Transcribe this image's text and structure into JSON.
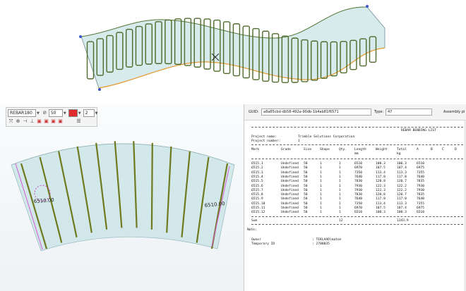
{
  "top_view": {
    "description_icon": "cursor-x"
  },
  "toolbar": {
    "profile_value": "REBAR180",
    "angle_value": "50",
    "count_value": "2"
  },
  "dimensions": {
    "left_label": "6510.00",
    "right_label": "6510.00"
  },
  "report_header": {
    "guid_label": "GUID:",
    "guid_value": "a8a85cbd-db58-492a-90db-1b4ab81f6571",
    "type_label": "Type:",
    "type_value": "47",
    "assembly_label": "Assembly pl"
  },
  "report": {
    "title": "REBAR BENDING LIST",
    "project_name_label": "Project name:",
    "project_name_value": "Trimble Solutions Corporation",
    "project_number_label": "Project number:",
    "project_number_value": "1",
    "columns": [
      "Mark",
      "Grade",
      "Size",
      "Shape",
      "Qty.",
      "Length",
      "Weight",
      "Total",
      "A",
      "B",
      "C",
      "D"
    ],
    "column_units": [
      "",
      "",
      "",
      "",
      "",
      "mm",
      "",
      "kg",
      "",
      "",
      "",
      ""
    ],
    "rows": [
      [
        "6515.1",
        "Undefined",
        "50",
        "1",
        "1",
        "6510",
        "100.3",
        "100.3",
        "6510"
      ],
      [
        "6515.2",
        "Undefined",
        "50",
        "1",
        "1",
        "6970",
        "107.5",
        "107.4",
        "6975"
      ],
      [
        "6515.3",
        "Undefined",
        "50",
        "1",
        "1",
        "7350",
        "113.4",
        "113.3",
        "7355"
      ],
      [
        "6515.4",
        "Undefined",
        "50",
        "1",
        "1",
        "7640",
        "117.8",
        "117.8",
        "7640"
      ],
      [
        "6515.5",
        "Undefined",
        "50",
        "1",
        "1",
        "7830",
        "120.8",
        "120.7",
        "7835"
      ],
      [
        "6515.6",
        "Undefined",
        "50",
        "1",
        "1",
        "7930",
        "122.3",
        "122.2",
        "7930"
      ],
      [
        "6515.7",
        "Undefined",
        "50",
        "1",
        "1",
        "7930",
        "122.3",
        "122.2",
        "7930"
      ],
      [
        "6515.8",
        "Undefined",
        "50",
        "1",
        "1",
        "7830",
        "120.8",
        "120.7",
        "7835"
      ],
      [
        "6515.9",
        "Undefined",
        "50",
        "1",
        "1",
        "7640",
        "117.8",
        "117.8",
        "7640"
      ],
      [
        "6515.10",
        "Undefined",
        "50",
        "1",
        "1",
        "7350",
        "113.4",
        "113.3",
        "7355"
      ],
      [
        "6515.11",
        "Undefined",
        "50",
        "1",
        "1",
        "6970",
        "107.5",
        "107.4",
        "6975"
      ],
      [
        "6515.12",
        "Undefined",
        "50",
        "1",
        "1",
        "6510",
        "100.3",
        "100.3",
        "6510"
      ]
    ],
    "sum_label": "Sum",
    "sum_qty": "12",
    "sum_total": "1343.9",
    "note_label": "Note:",
    "owner_label": "Owner",
    "owner_value": ": TEKLAAD\\maton",
    "temp_id_label": "Temporary ID",
    "temp_id_value": ": 2708035"
  },
  "colors": {
    "rebar": "#4d6b2a",
    "slab": "#c9e3e6",
    "accent_orange": "#e89a2e",
    "magenta": "#d55bd5"
  }
}
